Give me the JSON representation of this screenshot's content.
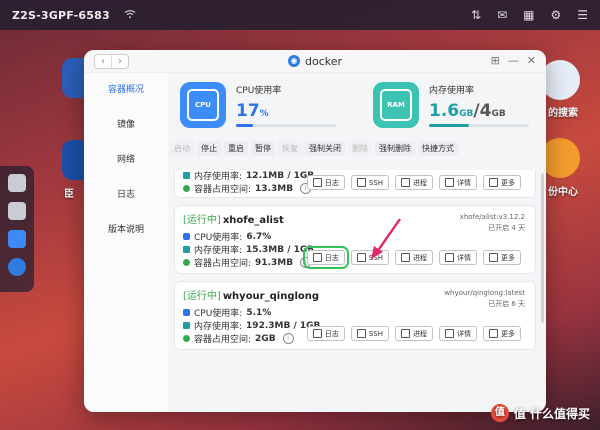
{
  "topbar": {
    "device": "Z2S-3GPF-6583",
    "wifi": "wifi-icon"
  },
  "desktop": {
    "right_labels": [
      "的搜索",
      "份中心"
    ],
    "left_label": "臣"
  },
  "window": {
    "title": "docker",
    "sidebar": [
      "容器概况",
      "镜像",
      "网络",
      "日志",
      "版本说明"
    ],
    "active_sidebar": 0
  },
  "stats": {
    "cpu": {
      "label": "CPU使用率",
      "value": "17",
      "unit": "%",
      "progress": 0.17
    },
    "mem": {
      "label": "内存使用率",
      "used": "1.6",
      "used_unit": "GB",
      "total": "4",
      "total_unit": "GB",
      "progress": 0.4
    },
    "chip_cpu": "CPU",
    "chip_mem": "RAM"
  },
  "toolbar": [
    "启动",
    "停止",
    "重启",
    "暂停",
    "恢复",
    "强制关闭",
    "删除",
    "强制删除",
    "快捷方式"
  ],
  "toolbar_disabled": [
    0,
    4,
    6
  ],
  "actions": {
    "log": "日志",
    "ssh": "SSH",
    "process": "进程",
    "detail": "详情",
    "more": "更多"
  },
  "containers": [
    {
      "partial": true,
      "mem_label": "内存使用率:",
      "mem": "12.1MB / 1GB",
      "disk_label": "容器占用空间:",
      "disk": "13.3MB"
    },
    {
      "status": "[运行中]",
      "name": "xhofe_alist",
      "image": "xhofe/alist:v3.12.2",
      "uptime": "已开启 4 天",
      "cpu_label": "CPU使用率:",
      "cpu": "6.7%",
      "mem_label": "内存使用率:",
      "mem": "15.3MB / 1GB",
      "disk_label": "容器占用空间:",
      "disk": "91.3MB"
    },
    {
      "status": "[运行中]",
      "name": "whyour_qinglong",
      "image": "whyour/qinglong:latest",
      "uptime": "已开启 6 天",
      "cpu_label": "CPU使用率:",
      "cpu": "5.1%",
      "mem_label": "内存使用率:",
      "mem": "192.3MB / 1GB",
      "disk_label": "容器占用空间:",
      "disk": "2GB"
    }
  ],
  "watermark": "值 什么值得买",
  "colors": {
    "accent": "#2f73ec",
    "running": "#3caa4d",
    "highlight": "#35c25a",
    "arrow": "#e0286c"
  }
}
